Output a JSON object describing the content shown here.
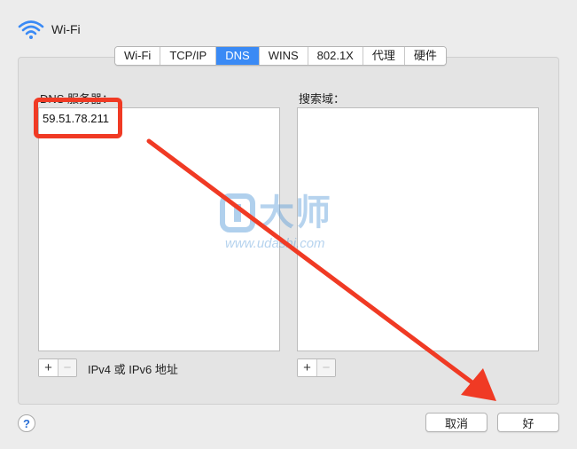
{
  "header": {
    "title": "Wi-Fi",
    "icon": "wifi-icon"
  },
  "tabs": [
    {
      "label": "Wi-Fi",
      "active": false
    },
    {
      "label": "TCP/IP",
      "active": false
    },
    {
      "label": "DNS",
      "active": true
    },
    {
      "label": "WINS",
      "active": false
    },
    {
      "label": "802.1X",
      "active": false
    },
    {
      "label": "代理",
      "active": false
    },
    {
      "label": "硬件",
      "active": false
    }
  ],
  "dns": {
    "label": "DNS 服务器：",
    "entries": [
      "59.51.78.211"
    ],
    "add_label": "+",
    "remove_label": "−",
    "hint": "IPv4 或 IPv6 地址"
  },
  "search": {
    "label": "搜索域：",
    "entries": [],
    "add_label": "+",
    "remove_label": "−"
  },
  "footer": {
    "help_label": "?",
    "cancel_label": "取消",
    "ok_label": "好"
  },
  "watermark": {
    "cn": "大师",
    "url": "www.udashi.com"
  },
  "colors": {
    "accent": "#3a8af5",
    "annotation": "#f03a24"
  }
}
